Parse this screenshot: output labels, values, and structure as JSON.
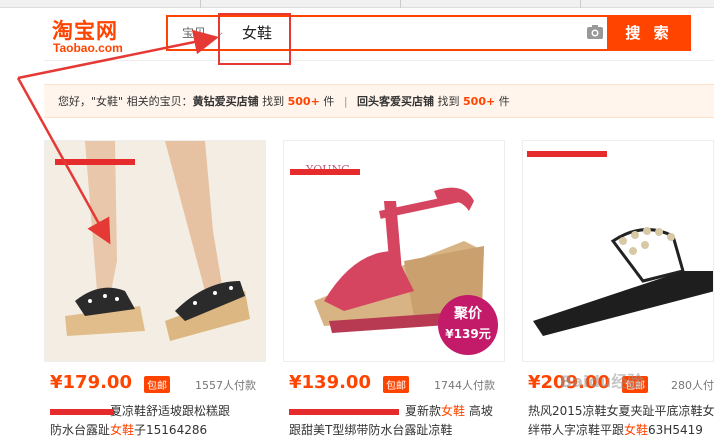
{
  "header": {
    "logo_main": "淘宝网",
    "logo_sub": "Taobao.com",
    "search_type": "宝贝",
    "search_query": "女鞋",
    "search_button": "搜 索"
  },
  "notice": {
    "prefix": "您好，\"女鞋\" 相关的宝贝：",
    "store1": "黄钻爱买店铺",
    "found1": "找到",
    "count1": "500+",
    "unit1": "件",
    "store2": "回头客爱买店铺",
    "found2": "找到",
    "count2": "500+",
    "unit2": "件"
  },
  "products": [
    {
      "price": "¥179.00",
      "free_ship": "包邮",
      "sold": "1557人付款",
      "title_line1": "夏凉鞋舒适坡跟松糕跟",
      "title_line2": "防水台露趾",
      "title_hl": "女鞋",
      "title_line2_tail": "子15164286"
    },
    {
      "price": "¥139.00",
      "free_ship": "包邮",
      "sold": "1744人付款",
      "title_line1": "夏新款",
      "title_hl1": "女鞋",
      "title_line1_tail": " 高坡",
      "title_line2": "跟甜美T型绑带防水台露趾凉鞋",
      "promo_t1": "聚价",
      "promo_t2": "¥139元",
      "brand": "YOUNG"
    },
    {
      "price": "¥209.00",
      "free_ship": "包邮",
      "sold": "280人付",
      "title_line1": "热风2015凉鞋女夏夹趾平底凉鞋女",
      "title_line2": "绊带人字凉鞋平跟",
      "title_hl": "女鞋",
      "title_line2_tail": "63H5419"
    }
  ],
  "watermark": "Baidu经验",
  "colors": {
    "accent": "#ff4400",
    "annotation": "#e53935",
    "promo": "#c31b6a"
  }
}
